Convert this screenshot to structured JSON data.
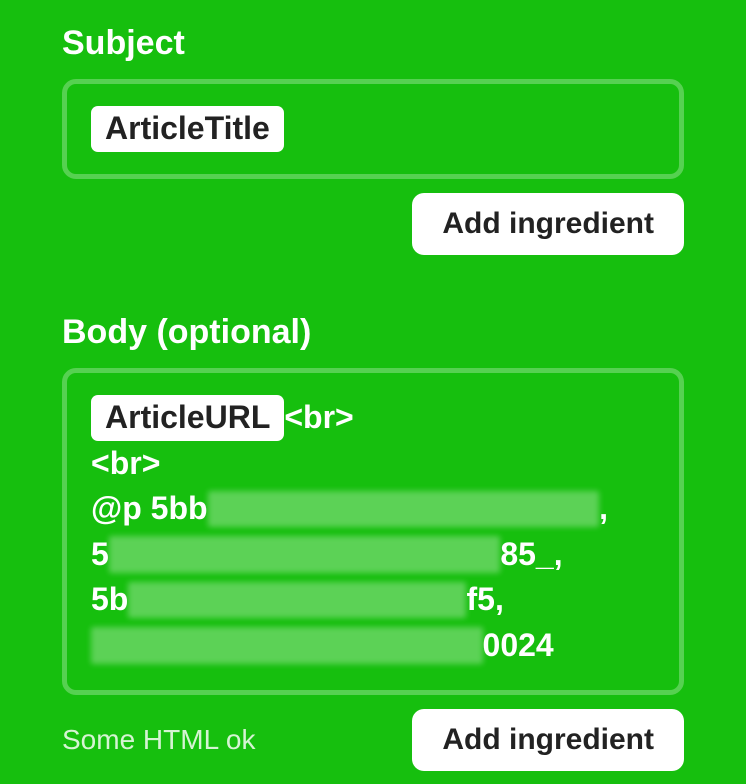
{
  "subject": {
    "label": "Subject",
    "ingredient": "ArticleTitle",
    "add_button": "Add ingredient"
  },
  "body": {
    "label": "Body (optional)",
    "ingredient": "ArticleURL",
    "lines": {
      "after_ingredient": "<br>",
      "line2": "<br>",
      "line3_prefix": "@p 5bb",
      "line3_blur": "0000000000000000000000",
      "line3_suffix": ",",
      "line4_prefix": "5",
      "line4_blur": "0000000000000000000000",
      "line4_suffix": "85_,",
      "line5_prefix": "5b",
      "line5_blur": "0000000000000000000",
      "line5_suffix": "f5,",
      "line6_blur": "0000000000000000000000",
      "line6_suffix": "0024"
    },
    "hint": "Some HTML ok",
    "add_button": "Add ingredient"
  }
}
